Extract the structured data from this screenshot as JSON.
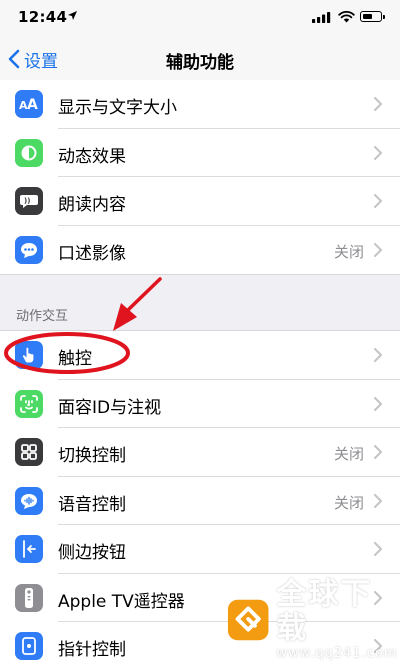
{
  "status_bar": {
    "time": "12:44"
  },
  "nav": {
    "back_label": "设置",
    "title": "辅助功能"
  },
  "vision_rows": [
    {
      "label": "显示与文字大小",
      "value": "",
      "icon": "text-size-icon",
      "color": "#2f7cf6"
    },
    {
      "label": "动态效果",
      "value": "",
      "icon": "motion-icon",
      "color": "#4cd964"
    },
    {
      "label": "朗读内容",
      "value": "",
      "icon": "spoken-content-icon",
      "color": "#3a3a3c"
    },
    {
      "label": "口述影像",
      "value": "关闭",
      "icon": "audio-description-icon",
      "color": "#2f7cf6"
    }
  ],
  "section_header": "动作交互",
  "interaction_rows": [
    {
      "label": "触控",
      "value": "",
      "icon": "touch-icon",
      "color": "#2f7cf6"
    },
    {
      "label": "面容ID与注视",
      "value": "",
      "icon": "face-id-icon",
      "color": "#4cd964"
    },
    {
      "label": "切换控制",
      "value": "关闭",
      "icon": "switch-control-icon",
      "color": "#3a3a3c"
    },
    {
      "label": "语音控制",
      "value": "关闭",
      "icon": "voice-control-icon",
      "color": "#2f7cf6"
    },
    {
      "label": "侧边按钮",
      "value": "",
      "icon": "side-button-icon",
      "color": "#2f7cf6"
    },
    {
      "label": "Apple TV遥控器",
      "value": "",
      "icon": "apple-tv-remote-icon",
      "color": "#8e8e93"
    },
    {
      "label": "指针控制",
      "value": "",
      "icon": "pointer-control-icon",
      "color": "#2f7cf6"
    }
  ],
  "watermark": {
    "main": "全球下载",
    "url": "www.qq241.com",
    "color": "#f39c12"
  }
}
